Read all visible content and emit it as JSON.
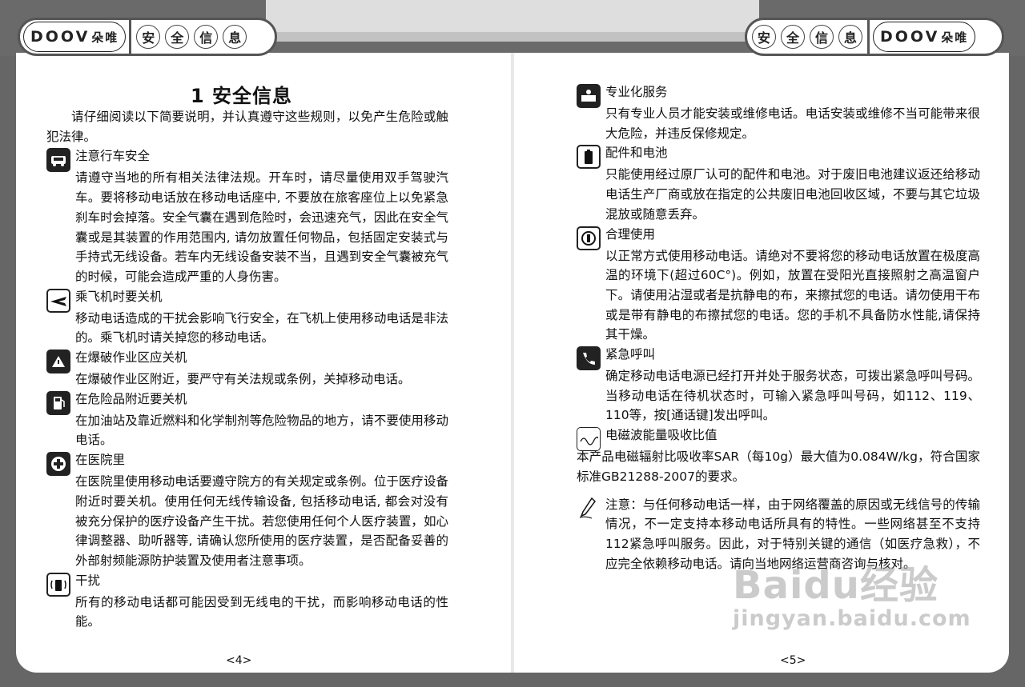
{
  "header": {
    "logo_latin": "DOOV",
    "logo_cn": "朵唯",
    "section_chars": [
      "安",
      "全",
      "信",
      "息"
    ]
  },
  "left_page": {
    "title": "1  安全信息",
    "intro": "请仔细阅读以下简要说明，并认真遵守这些规则，以免产生危险或触犯法律。",
    "sections": [
      {
        "icon": "car-icon",
        "heading": "注意行车安全",
        "body": "请遵守当地的所有相关法律法规。开车时，请尽量使用双手驾驶汽车。要将移动电话放在移动电话座中, 不要放在旅客座位上以免紧急刹车时会掉落。安全气囊在遇到危险时，会迅速充气，因此在安全气囊或是其装置的作用范围内, 请勿放置任何物品，包括固定安装式与手持式无线设备。若车内无线设备安装不当，且遇到安全气囊被充气的时候，可能会造成严重的人身伤害。"
      },
      {
        "icon": "airplane-icon",
        "heading": "乘飞机时要关机",
        "body": "移动电话造成的干扰会影响飞行安全，在飞机上使用移动电话是非法的。乘飞机时请关掉您的移动电话。"
      },
      {
        "icon": "blasting-icon",
        "heading": "在爆破作业区应关机",
        "body": "在爆破作业区附近，要严守有关法规或条例，关掉移动电话。"
      },
      {
        "icon": "fuel-pump-icon",
        "heading": "在危险品附近要关机",
        "body": "在加油站及靠近燃料和化学制剂等危险物品的地方，请不要使用移动电话。"
      },
      {
        "icon": "hospital-cross-icon",
        "heading": "在医院里",
        "body": "在医院里使用移动电话要遵守院方的有关规定或条例。位于医疗设备附近时要关机。使用任何无线传输设备, 包括移动电话, 都会对没有被充分保护的医疗设备产生干扰。若您使用任何个人医疗装置，如心律调整器、助听器等, 请确认您所使用的医疗装置，是否配备妥善的外部射频能源防护装置及使用者注意事项。"
      },
      {
        "icon": "interference-icon",
        "heading": "干扰",
        "body": "所有的移动电话都可能因受到无线电的干扰，而影响移动电话的性能。"
      }
    ],
    "page_number": "<4>"
  },
  "right_page": {
    "sections": [
      {
        "icon": "service-icon",
        "heading": "专业化服务",
        "body": "只有专业人员才能安装或维修电话。电话安装或维修不当可能带来很大危险，并违反保修规定。"
      },
      {
        "icon": "battery-icon",
        "heading": "配件和电池",
        "body": "只能使用经过原厂认可的配件和电池。对于废旧电池建议返还给移动电话生产厂商或放在指定的公共废旧电池回收区域，不要与其它垃圾混放或随意丢弃。"
      },
      {
        "icon": "proper-use-icon",
        "heading": "合理使用",
        "body": "以正常方式使用移动电话。请绝对不要将您的移动电话放置在极度高温的环境下(超过60C°)。例如，放置在受阳光直接照射之高温窗户下。请使用沾湿或者是抗静电的布，来擦拭您的电话。请勿使用干布或是带有静电的布擦拭您的电话。您的手机不具备防水性能,请保持其干燥。"
      },
      {
        "icon": "emergency-call-icon",
        "heading": "紧急呼叫",
        "body": "确定移动电话电源已经打开并处于服务状态，可拨出紧急呼叫号码。当移动电话在待机状态时，可输入紧急呼叫号码，如112、119、110等，按[通话键]发出呼叫。"
      },
      {
        "icon": "sar-icon",
        "heading": "电磁波能量吸收比值",
        "body": "本产品电磁辐射比吸收率SAR（每10g）最大值为0.084W/kg，符合国家标准GB21288-2007的要求。"
      }
    ],
    "note_icon": "pencil-note-icon",
    "note": "注意：与任何移动电话一样，由于网络覆盖的原因或无线信号的传输情况，不一定支持本移动电话所具有的特性。一些网络甚至不支持112紧急呼叫服务。因此，对于特别关键的通信（如医疗急救），不应完全依赖移动电话。请向当地网络运营商咨询与核对。",
    "page_number": "<5>"
  },
  "watermark": {
    "line1": "Baidu经验",
    "line2": "jingyan.baidu.com"
  }
}
